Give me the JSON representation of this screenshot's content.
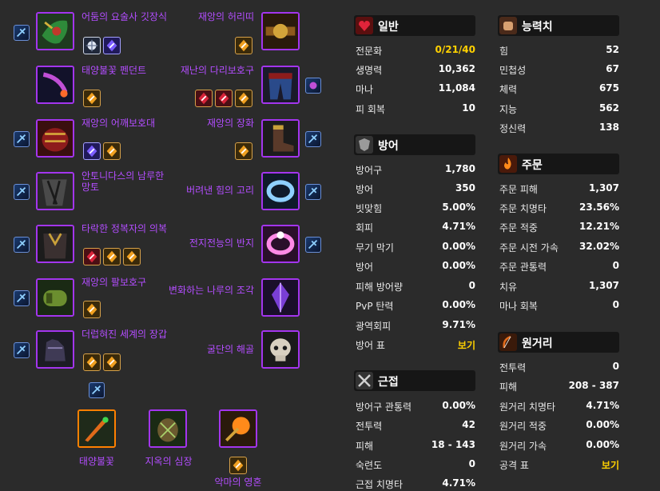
{
  "colors": {
    "epic": "#a335ee",
    "legendary": "#ff8000",
    "gold": "#ffd100",
    "bg": "#2b2b2b",
    "header": "#161616"
  },
  "left_items": [
    {
      "name": "어둠의 요술사 깃장식",
      "icon": "shoulder-pad-icon"
    },
    {
      "name": "태양불꽃 펜던트",
      "icon": "amulet-icon"
    },
    {
      "name": "재앙의 어깨보호대",
      "icon": "armor-icon"
    },
    {
      "name": "안토니다스의 남루한 망토",
      "icon": "cloak-icon"
    },
    {
      "name": "타락한 정복자의 의복",
      "icon": "chest-icon"
    },
    {
      "name": "재앙의 팔보호구",
      "icon": "bracer-icon"
    },
    {
      "name": "더럽혀진 세계의 장갑",
      "icon": "gloves-icon"
    }
  ],
  "right_items": [
    {
      "name": "재앙의 허리띠",
      "icon": "belt-icon"
    },
    {
      "name": "재난의 다리보호구",
      "icon": "pants-icon"
    },
    {
      "name": "재앙의 장화",
      "icon": "boots-icon"
    },
    {
      "name": "버려낸 힘의 고리",
      "icon": "ring-icon"
    },
    {
      "name": "전지전능의 반지",
      "icon": "ring-pink-icon"
    },
    {
      "name": "변화하는 나루의 조각",
      "icon": "crystal-icon"
    },
    {
      "name": "굴단의 해골",
      "icon": "skull-icon"
    }
  ],
  "weapons": [
    {
      "name": "태양불꽃",
      "icon": "dagger-icon"
    },
    {
      "name": "지옥의 심장",
      "icon": "offhand-icon"
    },
    {
      "name": "악마의 영혼",
      "icon": "wand-icon"
    }
  ],
  "stats": {
    "general": {
      "title": "일반",
      "icon": "heart-icon",
      "rows": [
        {
          "k": "전문화",
          "v": "0/21/40"
        },
        {
          "k": "생명력",
          "v": "10,362"
        },
        {
          "k": "마나",
          "v": "11,084"
        },
        {
          "k": "피 회복",
          "v": "10"
        }
      ]
    },
    "defense": {
      "title": "방어",
      "icon": "shield-icon",
      "rows": [
        {
          "k": "방어구",
          "v": "1,780"
        },
        {
          "k": "방어",
          "v": "350"
        },
        {
          "k": "빗맞힘",
          "v": "5.00%"
        },
        {
          "k": "회피",
          "v": "4.71%"
        },
        {
          "k": "무기 막기",
          "v": "0.00%"
        },
        {
          "k": "방어",
          "v": "0.00%"
        },
        {
          "k": "피해 방어량",
          "v": "0"
        },
        {
          "k": "PvP 탄력",
          "v": "0.00%"
        },
        {
          "k": "광역회피",
          "v": "9.71%"
        },
        {
          "k": "방어 표",
          "v": "보기"
        }
      ]
    },
    "melee": {
      "title": "근접",
      "icon": "swords-icon",
      "rows": [
        {
          "k": "방어구 관통력",
          "v": "0.00%"
        },
        {
          "k": "전투력",
          "v": "42"
        },
        {
          "k": "피해",
          "v": "18 - 143"
        },
        {
          "k": "숙련도",
          "v": "0"
        },
        {
          "k": "근접 치명타",
          "v": "4.71%"
        }
      ]
    },
    "attributes": {
      "title": "능력치",
      "icon": "fist-icon",
      "rows": [
        {
          "k": "힘",
          "v": "52"
        },
        {
          "k": "민첩성",
          "v": "67"
        },
        {
          "k": "체력",
          "v": "675"
        },
        {
          "k": "지능",
          "v": "562"
        },
        {
          "k": "정신력",
          "v": "138"
        }
      ]
    },
    "spell": {
      "title": "주문",
      "icon": "fire-icon",
      "rows": [
        {
          "k": "주문 피해",
          "v": "1,307"
        },
        {
          "k": "주문 치명타",
          "v": "23.56%"
        },
        {
          "k": "주문 적중",
          "v": "12.21%"
        },
        {
          "k": "주문 시전 가속",
          "v": "32.02%"
        },
        {
          "k": "주문 관통력",
          "v": "0"
        },
        {
          "k": "치유",
          "v": "1,307"
        },
        {
          "k": "마나 회복",
          "v": "0"
        }
      ]
    },
    "ranged": {
      "title": "원거리",
      "icon": "bow-icon",
      "rows": [
        {
          "k": "전투력",
          "v": "0"
        },
        {
          "k": "피해",
          "v": "208 - 387"
        },
        {
          "k": "원거리 치명타",
          "v": "4.71%"
        },
        {
          "k": "원거리 적중",
          "v": "0.00%"
        },
        {
          "k": "원거리 가속",
          "v": "0.00%"
        },
        {
          "k": "공격 표",
          "v": "보기"
        }
      ]
    }
  }
}
